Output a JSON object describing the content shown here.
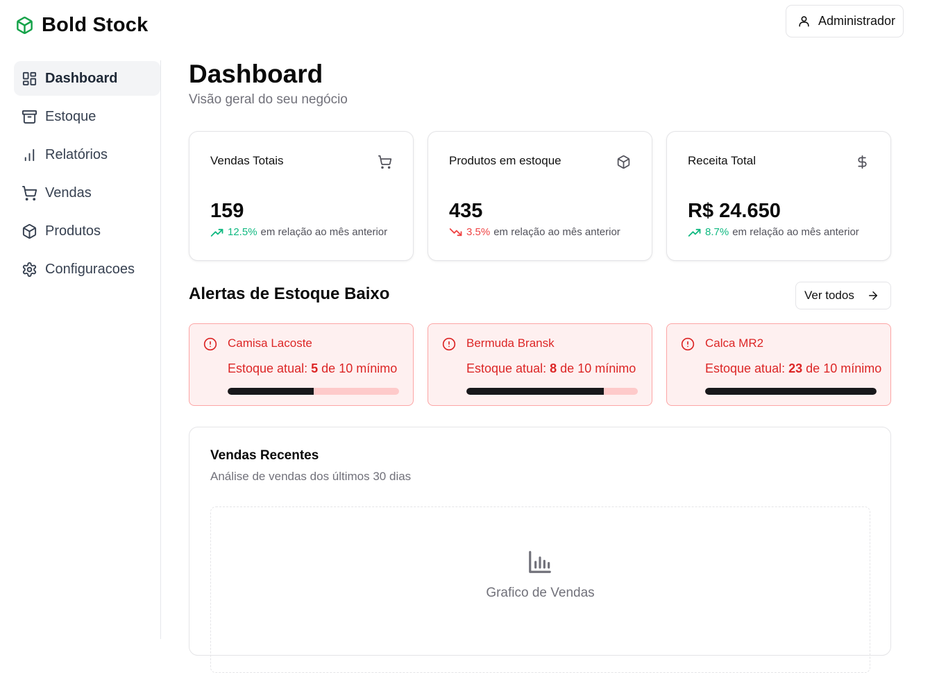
{
  "brand": {
    "name": "Bold Stock",
    "logo_icon": "package-icon",
    "accent": "#16a34a"
  },
  "user": {
    "label": "Administrador",
    "icon": "user-icon"
  },
  "sidebar": {
    "items": [
      {
        "label": "Dashboard",
        "icon": "layout-dashboard-icon",
        "active": true
      },
      {
        "label": "Estoque",
        "icon": "archive-icon",
        "active": false
      },
      {
        "label": "Relatórios",
        "icon": "bar-chart-icon",
        "active": false
      },
      {
        "label": "Vendas",
        "icon": "shopping-cart-icon",
        "active": false
      },
      {
        "label": "Produtos",
        "icon": "package-icon",
        "active": false
      },
      {
        "label": "Configuracoes",
        "icon": "settings-icon",
        "active": false
      }
    ]
  },
  "main": {
    "title": "Dashboard",
    "subtitle": "Visão geral do seu negócio",
    "stats": [
      {
        "title": "Vendas Totais",
        "icon": "shopping-cart-icon",
        "value": "159",
        "trend": "up",
        "percent": "12.5%",
        "comparison": "em relação ao mês anterior"
      },
      {
        "title": "Produtos em estoque",
        "icon": "package-icon",
        "value": "435",
        "trend": "down",
        "percent": "3.5%",
        "comparison": "em relação ao mês anterior"
      },
      {
        "title": "Receita Total",
        "icon": "dollar-sign-icon",
        "value": "R$ 24.650",
        "trend": "up",
        "percent": "8.7%",
        "comparison": "em relação ao mês anterior"
      }
    ],
    "alerts_section": {
      "title": "Alertas de Estoque Baixo",
      "view_all_label": "Ver todos",
      "stock_label": "Estoque atual:",
      "of_label": "de",
      "min_label": "mínimo",
      "items": [
        {
          "name": "Camisa Lacoste",
          "current": "5",
          "minimum": "10",
          "level": 0.5
        },
        {
          "name": "Bermuda Bransk",
          "current": "8",
          "minimum": "10",
          "level": 0.8
        },
        {
          "name": "Calca MR2",
          "current": "23",
          "minimum": "10",
          "level": 1.0
        }
      ]
    },
    "recent_sales": {
      "title": "Vendas Recentes",
      "subtitle": "Análise de vendas dos últimos 30 dias",
      "placeholder_label": "Grafico de Vendas",
      "placeholder_icon": "bar-chart-icon"
    }
  },
  "colors": {
    "trend_up": "#10b981",
    "trend_down": "#ef4444",
    "alert_text": "#dc2626",
    "alert_bg": "#fef0f0",
    "alert_border": "#fca5a5"
  }
}
